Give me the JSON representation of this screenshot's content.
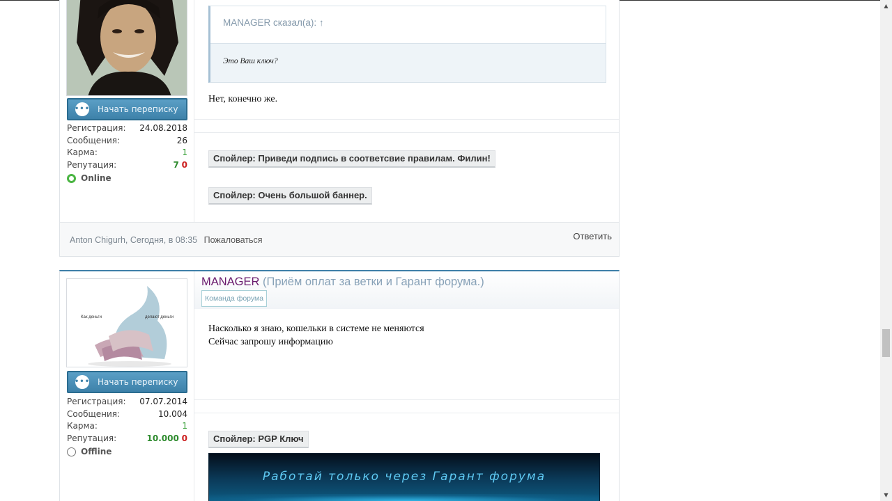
{
  "posts": [
    {
      "author": "Anton Chigurh",
      "pm_button": "Начать переписку",
      "stats": {
        "registration_label": "Регистрация:",
        "registration": "24.08.2018",
        "messages_label": "Сообщения:",
        "messages": "26",
        "karma_label": "Карма:",
        "karma": "1",
        "reputation_label": "Репутация:",
        "rep_positive": "7",
        "rep_negative": "0",
        "status": "Online"
      },
      "quote": {
        "header": "MANAGER сказал(а): ↑",
        "body": "Это Ваш ключ?"
      },
      "message": "Нет, конечно же.",
      "spoilers": [
        "Спойлер: Приведи подпись в соответсвие правилам. Филин!",
        "Спойлер: Очень большой баннер."
      ],
      "footer": {
        "meta": "Anton Chigurh, Сегодня, в 08:35",
        "report": "Пожаловаться",
        "reply": "Ответить"
      }
    },
    {
      "author": "MANAGER",
      "user_title": "(Приём оплат за ветки и Гарант форума.)",
      "badge": "Команда форума",
      "avatar_caption_left": "Как деньги",
      "avatar_caption_right": "делают деньги",
      "pm_button": "Начать переписку",
      "stats": {
        "registration_label": "Регистрация:",
        "registration": "07.07.2014",
        "messages_label": "Сообщения:",
        "messages": "10.004",
        "karma_label": "Карма:",
        "karma": "1",
        "reputation_label": "Репутация:",
        "rep_positive": "10.000",
        "rep_negative": "0",
        "status": "Offline"
      },
      "message_lines": [
        "Насколько я знаю, кошельки в системе не меняются",
        "Сейчас запрошу информацию"
      ],
      "spoiler": "Спойлер: PGP Ключ",
      "banner_text": "Работай только через Гарант форума"
    }
  ],
  "colors": {
    "accent": "#3e7fa8",
    "username": "#6a1a6d",
    "online": "#4bb543",
    "rep_positive": "#2e8b2e",
    "rep_negative": "#cc1f1f"
  },
  "icons": [
    "chat-bubble-icon",
    "online-status-icon",
    "offline-status-icon",
    "scroll-up-arrow-icon",
    "scroll-down-arrow-icon"
  ]
}
